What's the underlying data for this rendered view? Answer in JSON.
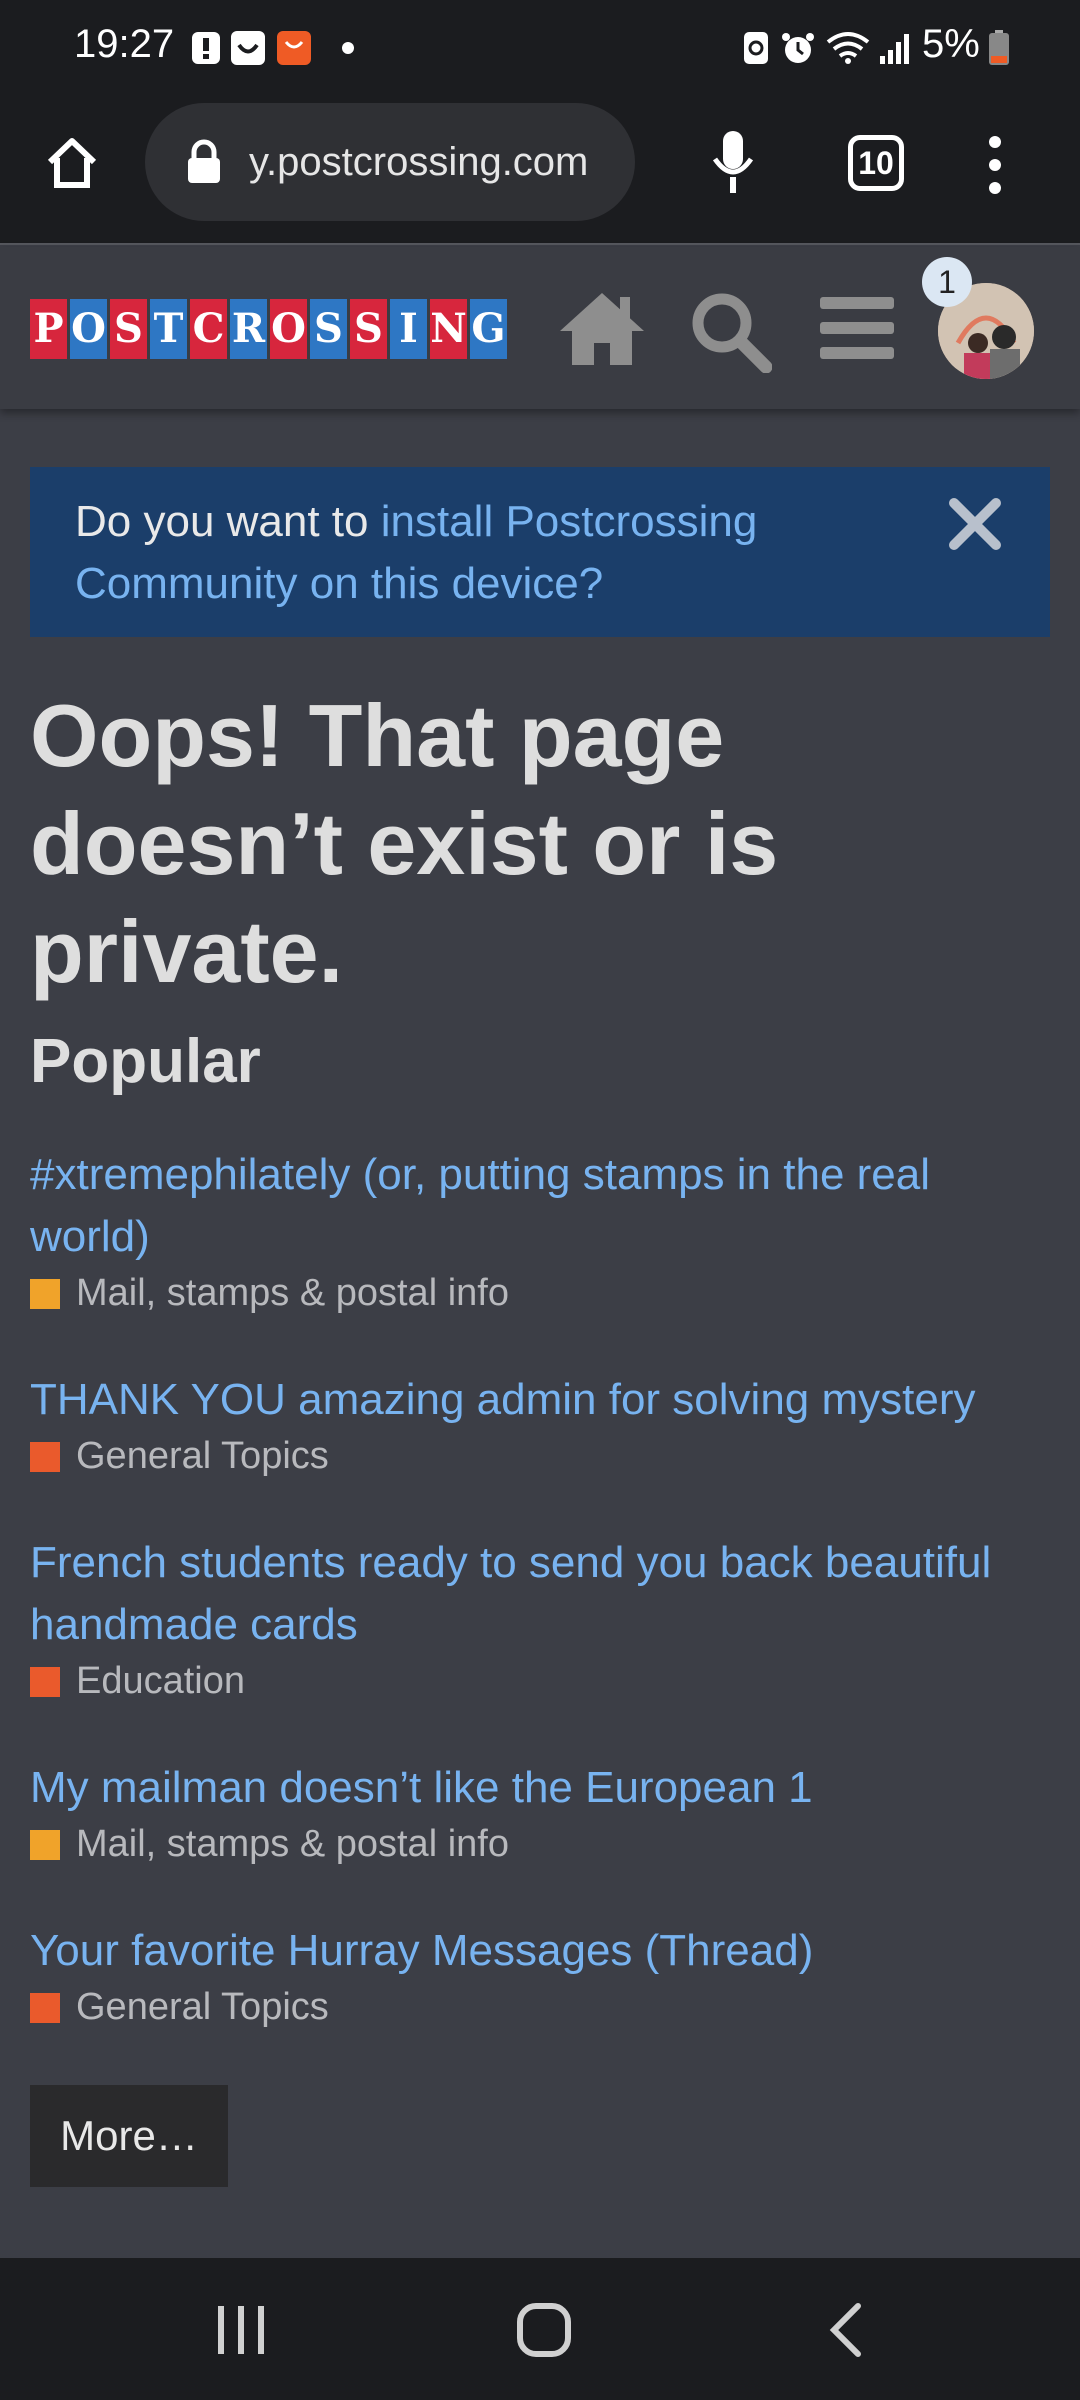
{
  "status_bar": {
    "time": "19:27",
    "battery_percent": "5%",
    "icons": [
      "alert-icon",
      "smile-app-icon",
      "shop-app-icon",
      "dot-icon",
      "recycle-icon",
      "alarm-icon",
      "wifi-icon",
      "signal-icon",
      "battery-icon"
    ]
  },
  "browser": {
    "url": "y.postcrossing.com",
    "tab_count": "10",
    "icons": [
      "home-icon",
      "lock-icon",
      "mic-icon",
      "tabs-icon",
      "more-vert-icon"
    ]
  },
  "site_header": {
    "logo_text": "POSTCROSSING",
    "notification_count": "1",
    "icons": [
      "home-icon",
      "search-icon",
      "menu-icon",
      "avatar"
    ]
  },
  "banner": {
    "prefix": "Do you want to ",
    "link": "install Postcrossing Community on this device?"
  },
  "main": {
    "headline": "Oops! That page doesn’t exist or is private.",
    "popular_heading": "Popular",
    "topics": [
      {
        "title": "#xtremephilately (or, putting stamps in the real world)",
        "category": "Mail, stamps & postal info",
        "color": "#f0a32a"
      },
      {
        "title": "THANK YOU amazing admin for solving mystery",
        "category": "General Topics",
        "color": "#ea5a2c"
      },
      {
        "title": "French students ready to send you back beautiful handmade cards",
        "category": "Education",
        "color": "#ea5a2c"
      },
      {
        "title": "My mailman doesn’t like the European 1",
        "category": "Mail, stamps & postal info",
        "color": "#f0a32a"
      },
      {
        "title": "Your favorite Hurray Messages (Thread)",
        "category": "General Topics",
        "color": "#ea5a2c"
      }
    ],
    "more_button": "More…"
  },
  "colors": {
    "page_bg": "#3c3e46",
    "link": "#78b3f0",
    "banner_bg": "#1b3e6a",
    "logo_red": "#d7263d",
    "logo_blue": "#2e77c4"
  }
}
